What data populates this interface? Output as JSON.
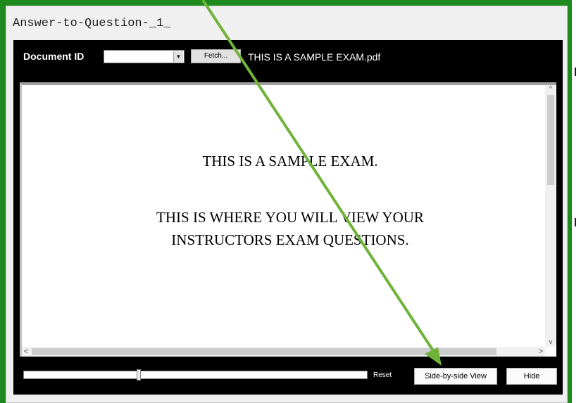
{
  "panel": {
    "title": "Answer-to-Question-_1_"
  },
  "toolbar": {
    "document_id_label": "Document ID",
    "document_id_value": "",
    "fetch_label": "Fetch...",
    "filename": "THIS IS A SAMPLE EXAM.pdf"
  },
  "document": {
    "line1": "THIS IS A SAMPLE EXAM.",
    "line2": "THIS IS WHERE YOU WILL VIEW YOUR",
    "line3": "INSTRUCTORS EXAM QUESTIONS."
  },
  "footer": {
    "reset_label": "Reset",
    "side_by_side_label": "Side-by-side View",
    "hide_label": "Hide"
  },
  "icons": {
    "dropdown": "chevron-down-icon",
    "scroll_up": "caret-up-icon",
    "scroll_down": "caret-down-icon",
    "scroll_left": "caret-left-icon",
    "scroll_right": "caret-right-icon",
    "annotation": "pointer-arrow-icon"
  },
  "colors": {
    "frame_green": "#1e8a1e",
    "annotation_arrow": "#6fb33a",
    "toolbar_bg": "#000000"
  }
}
